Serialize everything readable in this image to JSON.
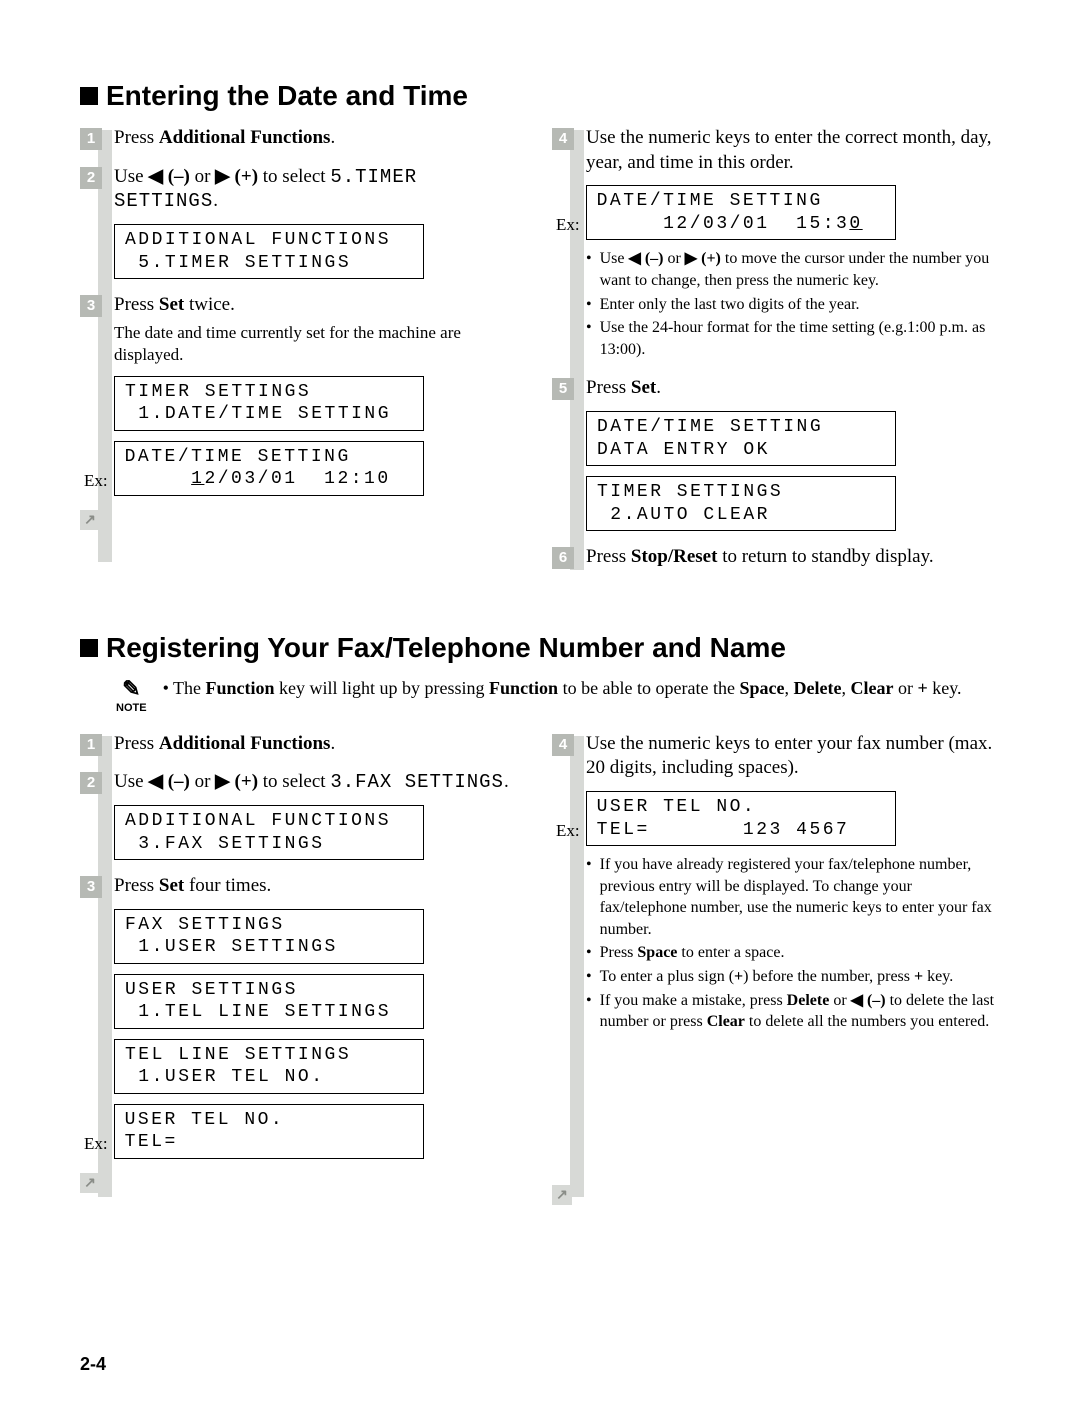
{
  "page_number": "2-4",
  "section1": {
    "heading": "Entering the Date and Time",
    "step1": {
      "num": "1",
      "text_parts": [
        "Press ",
        "Additional Functions",
        "."
      ]
    },
    "step2": {
      "num": "2",
      "parts": [
        "Use ",
        "◀",
        " (–)",
        " or ",
        "▶",
        " (+)",
        " to select ",
        "5.TIMER SETTINGS",
        "."
      ],
      "lcd": "ADDITIONAL FUNCTIONS\n 5.TIMER SETTINGS"
    },
    "step3": {
      "num": "3",
      "parts": [
        "Press ",
        "Set",
        " twice."
      ],
      "sub": "The date and time currently set for the machine are displayed.",
      "lcd1": "TIMER SETTINGS\n 1.DATE/TIME SETTING",
      "ex_label": "Ex:",
      "lcd2_l1": "DATE/TIME SETTING",
      "lcd2_l2a": "     ",
      "lcd2_l2b": "1",
      "lcd2_l2c": "2/03/01  12:10"
    },
    "step4": {
      "num": "4",
      "text": "Use the numeric keys to enter the correct month, day, year, and time in this order.",
      "ex_label": "Ex:",
      "lcd_l1": "DATE/TIME SETTING",
      "lcd_l2a": "     12/03/01  15:3",
      "lcd_l2b": "0",
      "notes": [
        {
          "pre": "Use ",
          "a1": "◀",
          "m1": " (–)",
          "mid": " or ",
          "a2": "▶",
          "m2": " (+)",
          "post": " to move the cursor under the number you want to change, then press the numeric key."
        },
        {
          "text": "Enter only the last two digits of the year."
        },
        {
          "text": "Use the 24-hour format for the time setting (e.g.1:00 p.m. as 13:00)."
        }
      ]
    },
    "step5": {
      "num": "5",
      "parts": [
        "Press ",
        "Set",
        "."
      ],
      "lcd1": "DATE/TIME SETTING\nDATA ENTRY OK",
      "lcd2": "TIMER SETTINGS\n 2.AUTO CLEAR"
    },
    "step6": {
      "num": "6",
      "parts": [
        "Press ",
        "Stop/Reset",
        " to return to standby display."
      ]
    }
  },
  "section2": {
    "heading": "Registering Your Fax/Telephone Number and Name",
    "note_label": "NOTE",
    "note_parts": [
      "The ",
      "Function",
      " key will light up by pressing ",
      "Function",
      " to be able to operate the ",
      "Space",
      ", ",
      "Delete",
      ", ",
      "Clear",
      " or ",
      "+",
      " key."
    ],
    "step1": {
      "num": "1",
      "text_parts": [
        "Press ",
        "Additional Functions",
        "."
      ]
    },
    "step2": {
      "num": "2",
      "parts": [
        "Use ",
        "◀",
        " (–)",
        " or ",
        "▶",
        " (+)",
        " to select ",
        "3.FAX SETTINGS",
        "."
      ],
      "lcd": "ADDITIONAL FUNCTIONS\n 3.FAX SETTINGS"
    },
    "step3": {
      "num": "3",
      "parts": [
        "Press ",
        "Set",
        " four times."
      ],
      "lcd1": "FAX SETTINGS\n 1.USER SETTINGS",
      "lcd2": "USER SETTINGS\n 1.TEL LINE SETTINGS",
      "lcd3": "TEL LINE SETTINGS\n 1.USER TEL NO.",
      "ex_label": "Ex:",
      "lcd4": "USER TEL NO.\nTEL="
    },
    "step4": {
      "num": "4",
      "text": "Use the numeric keys to enter your fax number (max. 20 digits, including spaces).",
      "ex_label": "Ex:",
      "lcd": "USER TEL NO.\nTEL=       123 4567",
      "notes": [
        {
          "text": "If you have already registered your fax/telephone number, previous entry will be displayed. To change your fax/telephone number, use the numeric keys to enter your fax number."
        },
        {
          "pre": "Press ",
          "b1": "Space",
          "post": " to enter a space."
        },
        {
          "pre": "To enter a plus sign (",
          "b1": "+",
          "mid": ") before the number, press ",
          "b2": "+",
          "post": " key."
        },
        {
          "pre": "If you make a mistake, press ",
          "b1": "Delete",
          "mid1": " or ",
          "a1": "◀",
          "m1": " (–)",
          "mid2": " to delete the last number or press ",
          "b2": "Clear",
          "post": " to delete all the numbers you entered."
        }
      ]
    }
  }
}
